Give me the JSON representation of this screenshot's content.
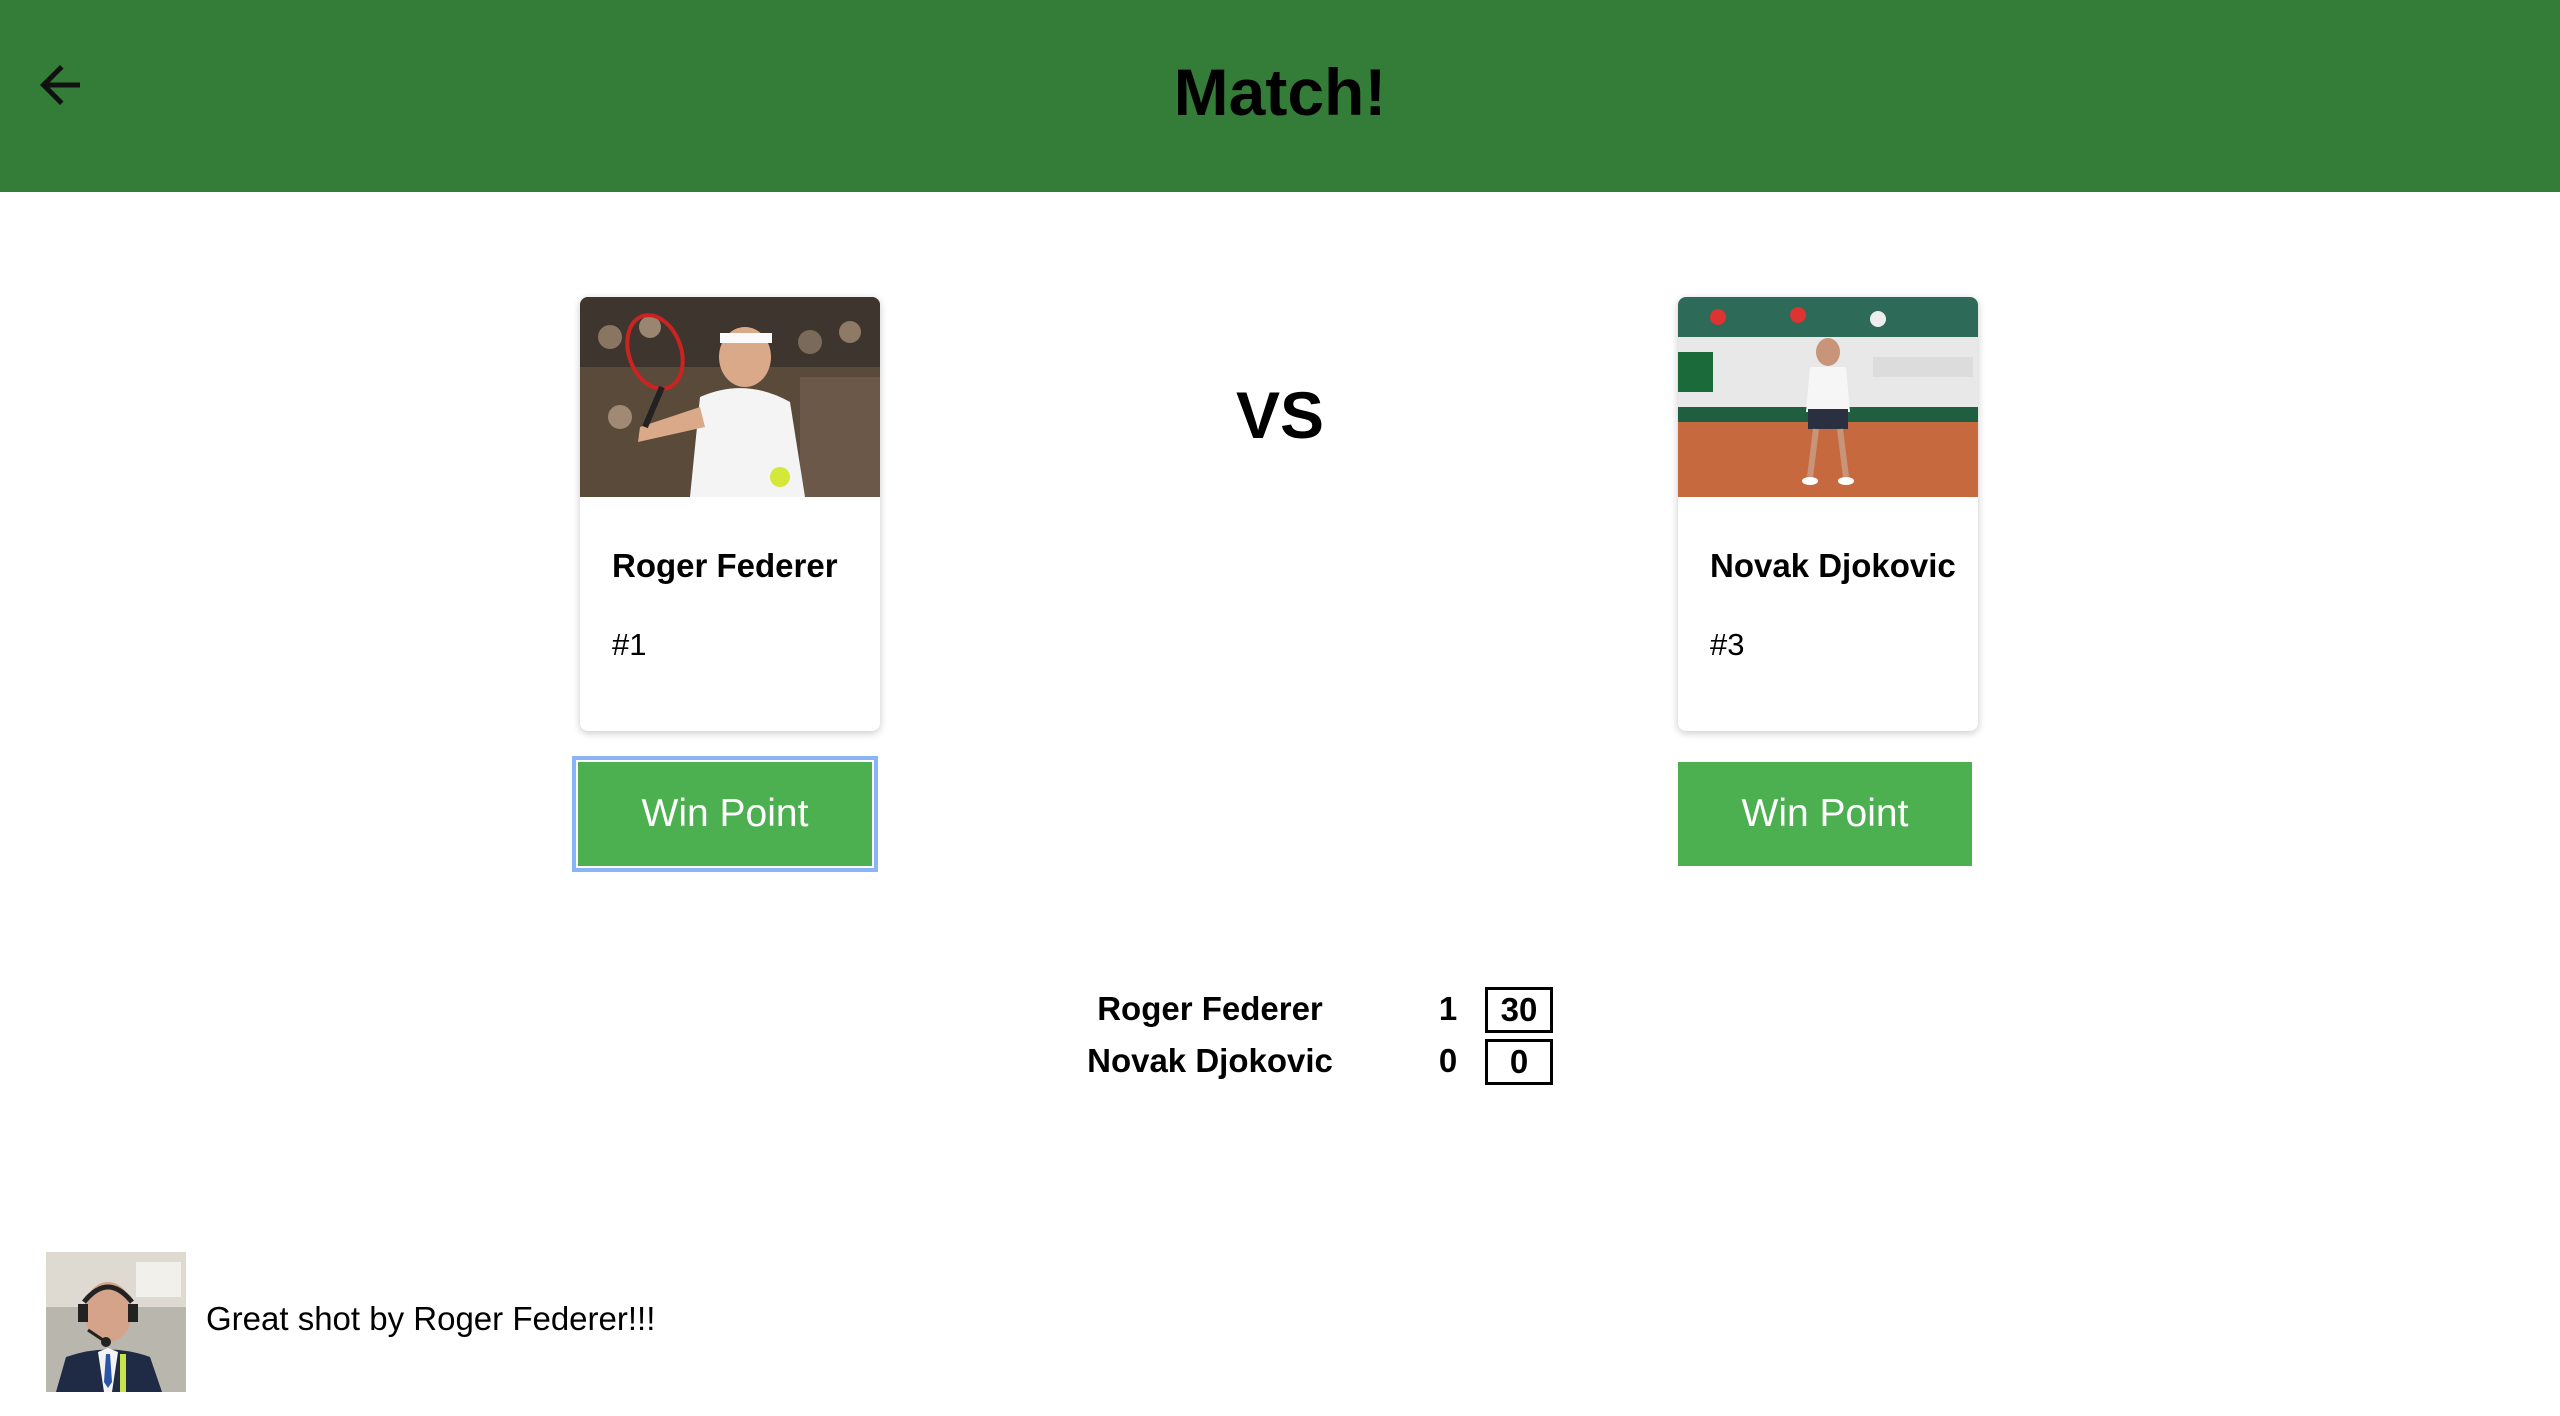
{
  "header": {
    "title": "Match!",
    "back_icon": "arrow-left-icon",
    "background_color": "#337d38"
  },
  "players": [
    {
      "name": "Roger Federer",
      "rank": "#1",
      "photo": "player-photo-federer"
    },
    {
      "name": "Novak Djokovic",
      "rank": "#3",
      "photo": "player-photo-djokovic"
    }
  ],
  "vs_label": "VS",
  "buttons": {
    "win_point_label": "Win Point",
    "color": "#4caf50"
  },
  "scoreboard": {
    "rows": [
      {
        "name": "Roger Federer",
        "sets": "1",
        "points": "30"
      },
      {
        "name": "Novak Djokovic",
        "sets": "0",
        "points": "0"
      }
    ]
  },
  "commentary": {
    "text": "Great shot by Roger Federer!!!",
    "avatar": "commentator-avatar"
  }
}
